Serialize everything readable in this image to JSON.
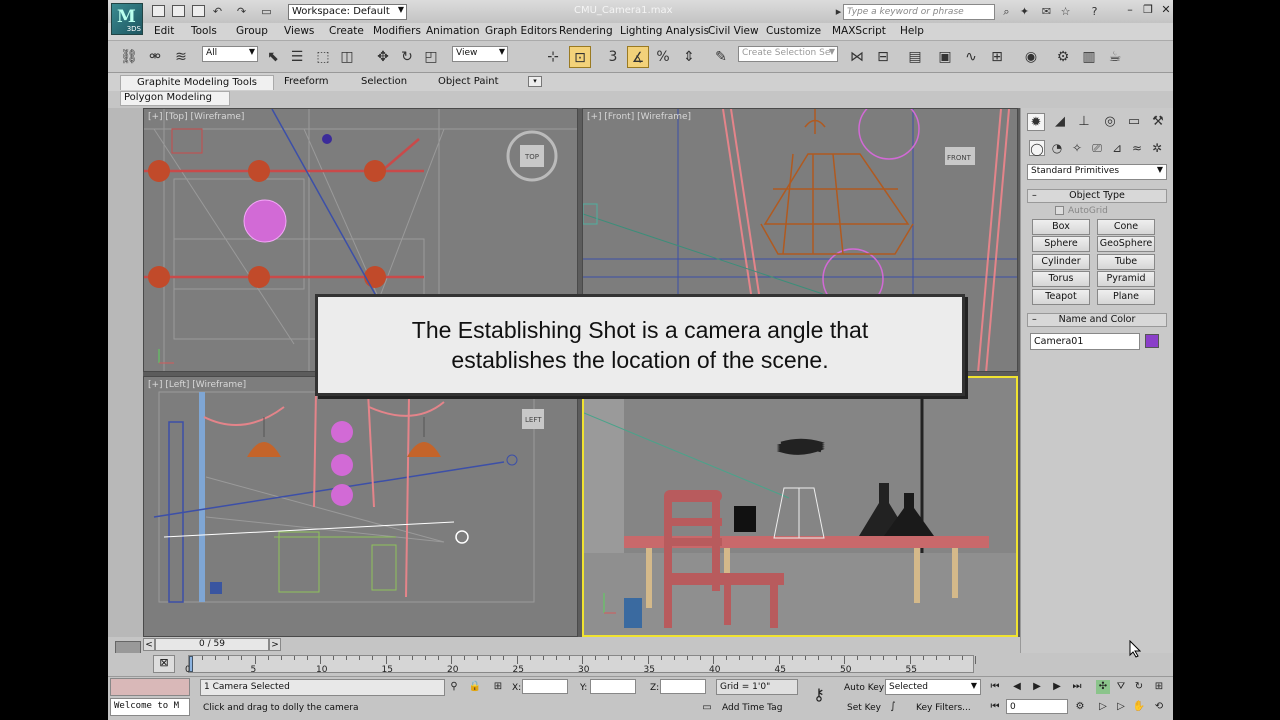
{
  "app": {
    "logo_text": "3DS",
    "logo_letter": "M",
    "workspace": "Workspace: Default",
    "file_title": "CMU_Camera1.max",
    "search_placeholder": "Type a keyword or phrase"
  },
  "menu": [
    "Edit",
    "Tools",
    "Group",
    "Views",
    "Create",
    "Modifiers",
    "Animation",
    "Graph Editors",
    "Rendering",
    "Lighting Analysis",
    "Civil View",
    "Customize",
    "MAXScript",
    "Help"
  ],
  "toolbar": {
    "selection_filter": "All",
    "reference_coord": "View",
    "snap_value": "3",
    "named_selection_placeholder": "Create Selection Se"
  },
  "ribbon": {
    "tabs": [
      "Graphite Modeling Tools",
      "Freeform",
      "Selection",
      "Object Paint"
    ],
    "sub_label": "Polygon Modeling"
  },
  "viewports": {
    "top": "[+] [Top] [Wireframe]",
    "front": "[+] [Front] [Wireframe]",
    "left": "[+] [Left] [Wireframe]",
    "top_cube": "TOP",
    "front_cube": "FRONT",
    "left_cube": "LEFT"
  },
  "caption": "The Establishing Shot is a camera angle that establishes the location of the scene.",
  "command_panel": {
    "category": "Standard Primitives",
    "object_type_title": "Object Type",
    "autogrid": "AutoGrid",
    "buttons": [
      "Box",
      "Cone",
      "Sphere",
      "GeoSphere",
      "Cylinder",
      "Tube",
      "Torus",
      "Pyramid",
      "Teapot",
      "Plane"
    ],
    "name_color_title": "Name and Color",
    "object_name": "Camera01",
    "object_color": "#8a3fc9"
  },
  "timeline": {
    "frame_display": "0 / 59",
    "ticks": [
      "0",
      "5",
      "10",
      "15",
      "20",
      "25",
      "30",
      "35",
      "40",
      "45",
      "50",
      "55"
    ]
  },
  "status": {
    "listener": "Welcome to M",
    "selection_info": "1 Camera Selected",
    "prompt": "Click and drag to dolly the camera",
    "x_label": "X:",
    "y_label": "Y:",
    "z_label": "Z:",
    "grid": "Grid = 1'0\"",
    "add_time_tag": "Add Time Tag",
    "auto_key": "Auto Key",
    "set_key": "Set Key",
    "selected": "Selected",
    "key_filters": "Key Filters...",
    "current_frame": "0"
  }
}
